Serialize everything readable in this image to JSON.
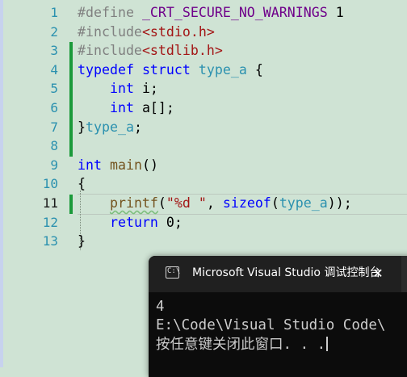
{
  "editor": {
    "line_numbers": [
      "1",
      "2",
      "3",
      "4",
      "5",
      "6",
      "7",
      "8",
      "9",
      "10",
      "11",
      "12",
      "13"
    ],
    "current_line_number": "11",
    "code": {
      "l1": [
        "#define ",
        "_CRT_SECURE_NO_WARNINGS",
        " 1"
      ],
      "l2": [
        "#include",
        "<stdio.h>"
      ],
      "l3": [
        "#include",
        "<stdlib.h>"
      ],
      "l4": [
        "typedef",
        " ",
        "struct",
        " ",
        "type_a",
        " {"
      ],
      "l5": [
        "    ",
        "int",
        " i;"
      ],
      "l6": [
        "    ",
        "int",
        " a[];"
      ],
      "l7": [
        "}",
        "type_a",
        ";"
      ],
      "l8": [
        ""
      ],
      "l9": [
        "int",
        " ",
        "main",
        "()"
      ],
      "l10": [
        "{"
      ],
      "l11": [
        "    ",
        "printf",
        "(",
        "\"%d \"",
        ", ",
        "sizeof",
        "(",
        "type_a",
        "));"
      ],
      "l12": [
        "    ",
        "return",
        " 0;"
      ],
      "l13": [
        "}"
      ]
    }
  },
  "console": {
    "title": "Microsoft Visual Studio 调试控制台",
    "close_glyph": "✕",
    "icon_glyph": "C:\\",
    "output": [
      "4",
      "E:\\Code\\Visual Studio Code\\",
      "按任意键关闭此窗口. . ."
    ]
  },
  "colors": {
    "editor_background": "#cfe3d4",
    "line_number": "#2b91af",
    "keyword": "#0000ff",
    "preprocessor": "#808080",
    "macro": "#6f008a",
    "string": "#a31515",
    "type": "#2b91af",
    "function": "#74531f",
    "change_bar": "#1b9a3a",
    "console_background": "#0c0c0c",
    "console_titlebar": "#202020",
    "console_text": "#cccccc"
  }
}
